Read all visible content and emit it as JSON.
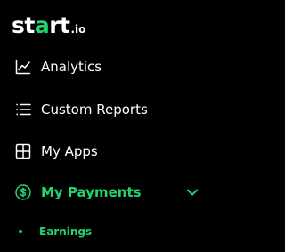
{
  "brand": {
    "logo_main_1": "st",
    "logo_accent": "a",
    "logo_main_2": "rt",
    "logo_suffix": ".io",
    "accent_color": "#22d36f"
  },
  "nav": {
    "items": [
      {
        "label": "Analytics",
        "icon": "chart-line-icon"
      },
      {
        "label": "Custom Reports",
        "icon": "list-icon"
      },
      {
        "label": "My Apps",
        "icon": "grid-icon"
      },
      {
        "label": "My Payments",
        "icon": "dollar-circle-icon",
        "active": true,
        "expanded": true
      }
    ],
    "payments_subitems": [
      {
        "label": "Earnings",
        "active": true
      }
    ]
  }
}
